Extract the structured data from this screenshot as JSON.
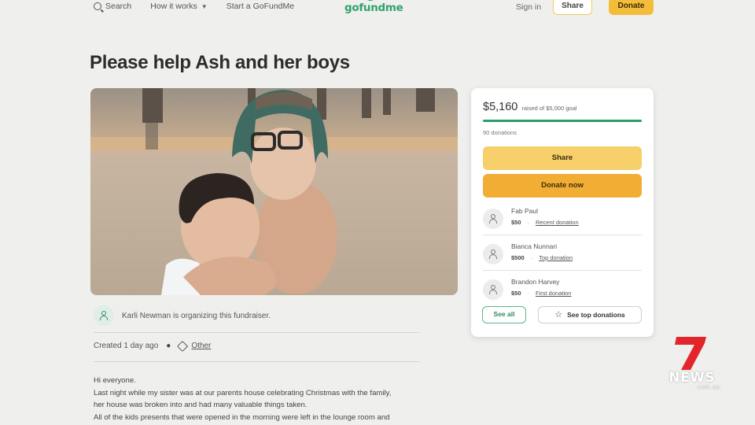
{
  "header": {
    "search_label": "Search",
    "how_it_works_label": "How it works",
    "start_label": "Start a GoFundMe",
    "logo_text": "gofundme",
    "signin_label": "Sign in",
    "share_label": "Share",
    "donate_label": "Donate",
    "brand_color": "#2fa36b",
    "donate_color": "#f4bc3b"
  },
  "campaign": {
    "title": "Please help Ash and her boys",
    "organizer_text": "Karli Newman is organizing this fundraiser.",
    "created_text": "Created 1 day ago",
    "category": "Other",
    "story_lines": [
      "Hi everyone.",
      "Last night while my sister was at our parents house celebrating Christmas with the family,",
      "her house was broken into and had many valuable things taken.",
      "All of the kids presents that were opened in the morning were left in the lounge room and"
    ]
  },
  "donation_card": {
    "amount_raised": "$5,160",
    "goal_text": "raised of $5,000 goal",
    "progress_fraction": 1.0,
    "donation_count": "90 donations",
    "share_label": "Share",
    "donate_now_label": "Donate now",
    "donors": [
      {
        "name": "Fab Paul",
        "amount": "$50",
        "type": "Recent donation"
      },
      {
        "name": "Bianca Nunnari",
        "amount": "$500",
        "type": "Top donation"
      },
      {
        "name": "Brandon Harvey",
        "amount": "$50",
        "type": "First donation"
      }
    ],
    "see_all_label": "See all",
    "see_top_label": "See top donations",
    "progress_color": "#2d9c6c"
  },
  "watermark": {
    "news_text": "NEWS",
    "domain_text": ".com.au",
    "logo_color": "#e3242b"
  }
}
